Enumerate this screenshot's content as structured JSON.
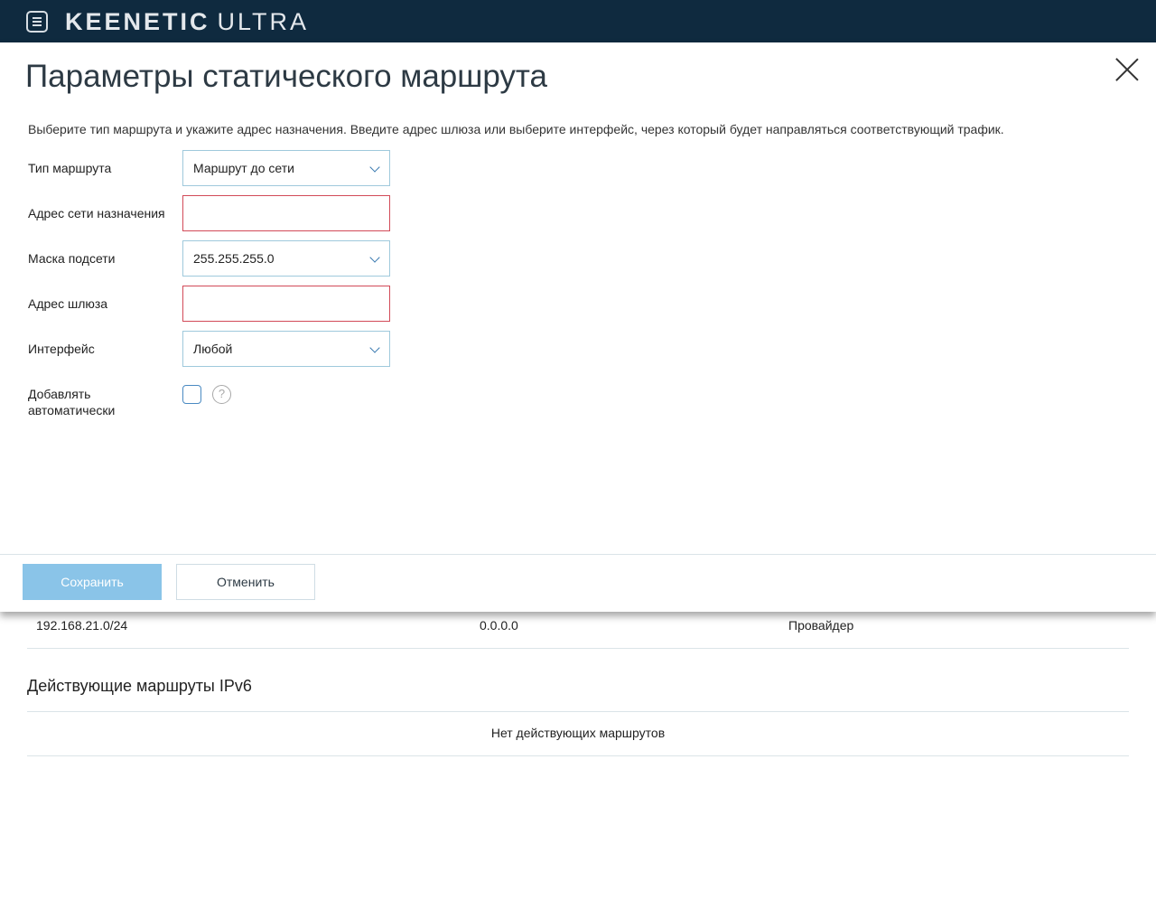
{
  "header": {
    "brand_main": "KEENETIC",
    "brand_model": "ULTRA"
  },
  "background": {
    "route_row": {
      "destination": "192.168.21.0/24",
      "gateway": "0.0.0.0",
      "interface": "Провайдер"
    },
    "ipv6_title": "Действующие маршруты IPv6",
    "ipv6_empty": "Нет действующих маршрутов"
  },
  "modal": {
    "title": "Параметры статического маршрута",
    "description": "Выберите тип маршрута и укажите адрес назначения. Введите адрес шлюза или выберите интерфейс, через который будет направляться соответствующий трафик.",
    "fields": {
      "route_type": {
        "label": "Тип маршрута",
        "value": "Маршрут до сети"
      },
      "dest_address": {
        "label": "Адрес сети назначения",
        "value": ""
      },
      "subnet_mask": {
        "label": "Маска подсети",
        "value": "255.255.255.0"
      },
      "gateway": {
        "label": "Адрес шлюза",
        "value": ""
      },
      "interface": {
        "label": "Интерфейс",
        "value": "Любой"
      },
      "auto_add": {
        "label_line1": "Добавлять",
        "label_line2": "автоматически",
        "checked": false,
        "help_glyph": "?"
      }
    },
    "buttons": {
      "save": "Сохранить",
      "cancel": "Отменить"
    }
  },
  "colors": {
    "topbar": "#0f2a3f",
    "field_border": "#9fc9dc",
    "error_border": "#d24a58",
    "save_button": "#8ac4e8"
  }
}
